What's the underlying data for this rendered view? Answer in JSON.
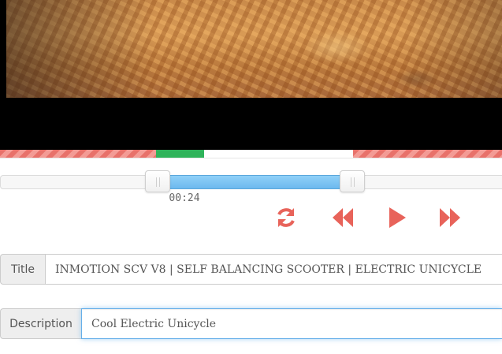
{
  "colors": {
    "accent": "#e8635a",
    "played": "#2fb35a",
    "range_fill": "#7cc4f3",
    "focus_border": "#66afe9"
  },
  "player": {
    "current_time": "00:24",
    "controls": {
      "repeat_icon": "repeat-icon",
      "rewind_icon": "rewind-icon",
      "play_icon": "play-icon",
      "forward_icon": "fast-forward-icon"
    }
  },
  "form": {
    "title_label": "Title",
    "title_value": "INMOTION SCV V8 | SELF BALANCING SCOOTER | ELECTRIC UNICYCLE",
    "description_label": "Description",
    "description_value": "Cool Electric Unicycle"
  }
}
